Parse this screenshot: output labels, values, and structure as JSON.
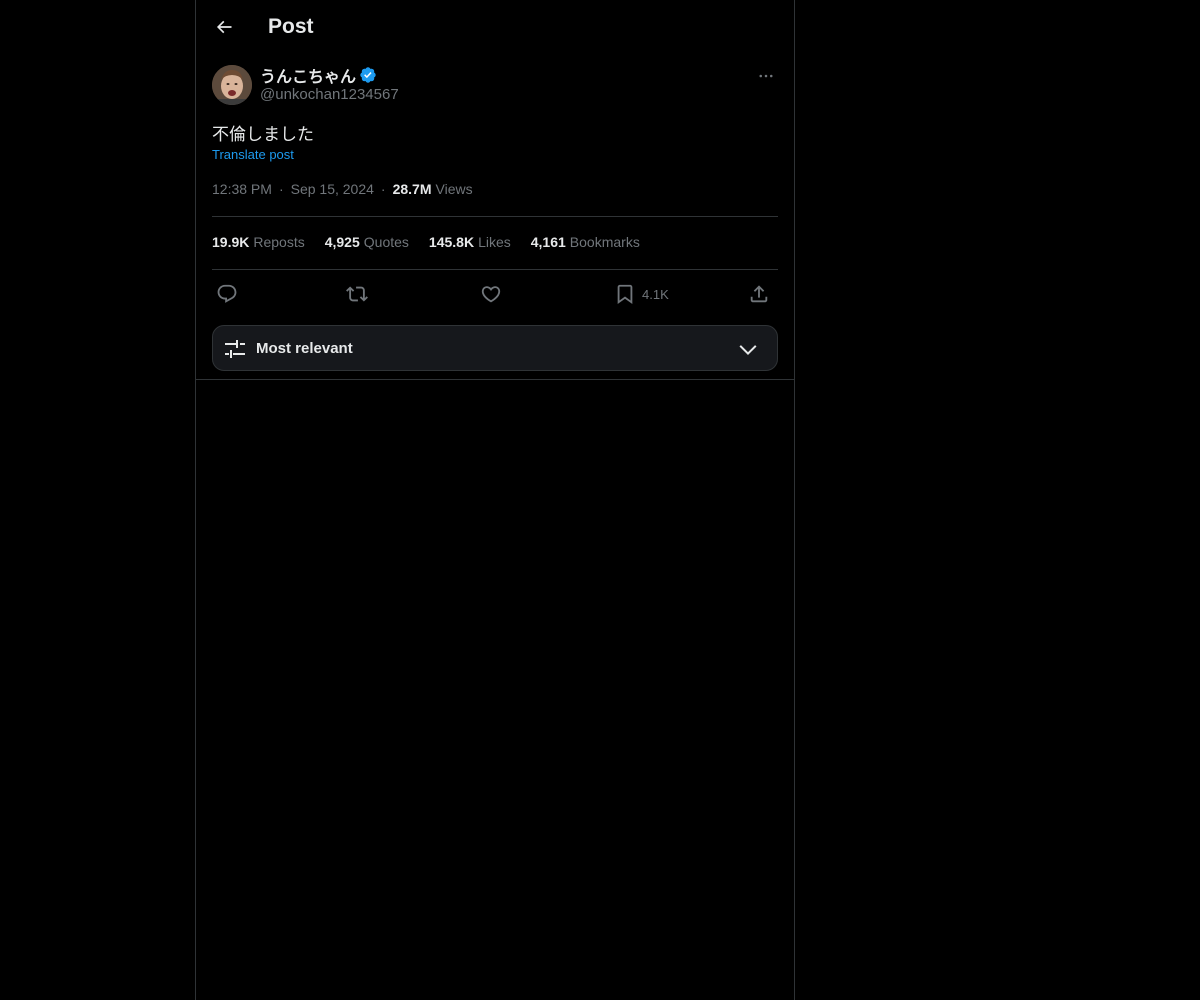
{
  "header": {
    "title": "Post",
    "back_icon": "back-arrow-icon"
  },
  "post": {
    "display_name": "うんこちゃん",
    "handle": "@unkochan1234567",
    "verified": true,
    "text": "不倫しました",
    "translate_label": "Translate post",
    "time": "12:38 PM",
    "date": "Sep 15, 2024",
    "views_count": "28.7M",
    "views_label": "Views",
    "separator": "·"
  },
  "stats": {
    "reposts": {
      "count": "19.9K",
      "label": "Reposts"
    },
    "quotes": {
      "count": "4,925",
      "label": "Quotes"
    },
    "likes": {
      "count": "145.8K",
      "label": "Likes"
    },
    "bookmarks": {
      "count": "4,161",
      "label": "Bookmarks"
    }
  },
  "actions": {
    "bookmark_count": "4.1K"
  },
  "sort": {
    "label": "Most relevant"
  },
  "colors": {
    "background": "#000000",
    "text_primary": "#e7e9ea",
    "text_secondary": "#71767b",
    "link": "#1d9bf0",
    "border": "#2f3336",
    "verified": "#1d9bf0"
  }
}
